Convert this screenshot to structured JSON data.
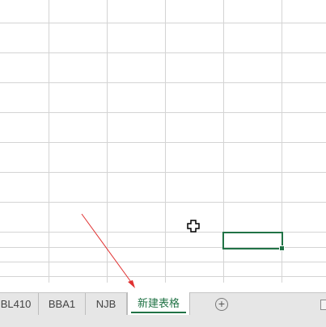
{
  "sheet_tabs": [
    {
      "label": "BL410",
      "active": false
    },
    {
      "label": "BBA1",
      "active": false
    },
    {
      "label": "NJB",
      "active": false
    },
    {
      "label": "新建表格",
      "active": true
    }
  ],
  "add_sheet_symbol": "+",
  "colors": {
    "accent": "#217346",
    "gridline": "#d4d4d4",
    "tab_bar": "#e6e6e6",
    "annotation_arrow": "#e03030"
  },
  "icons": {
    "cursor": "cross-cursor-icon",
    "add_sheet": "add-sheet-icon"
  }
}
